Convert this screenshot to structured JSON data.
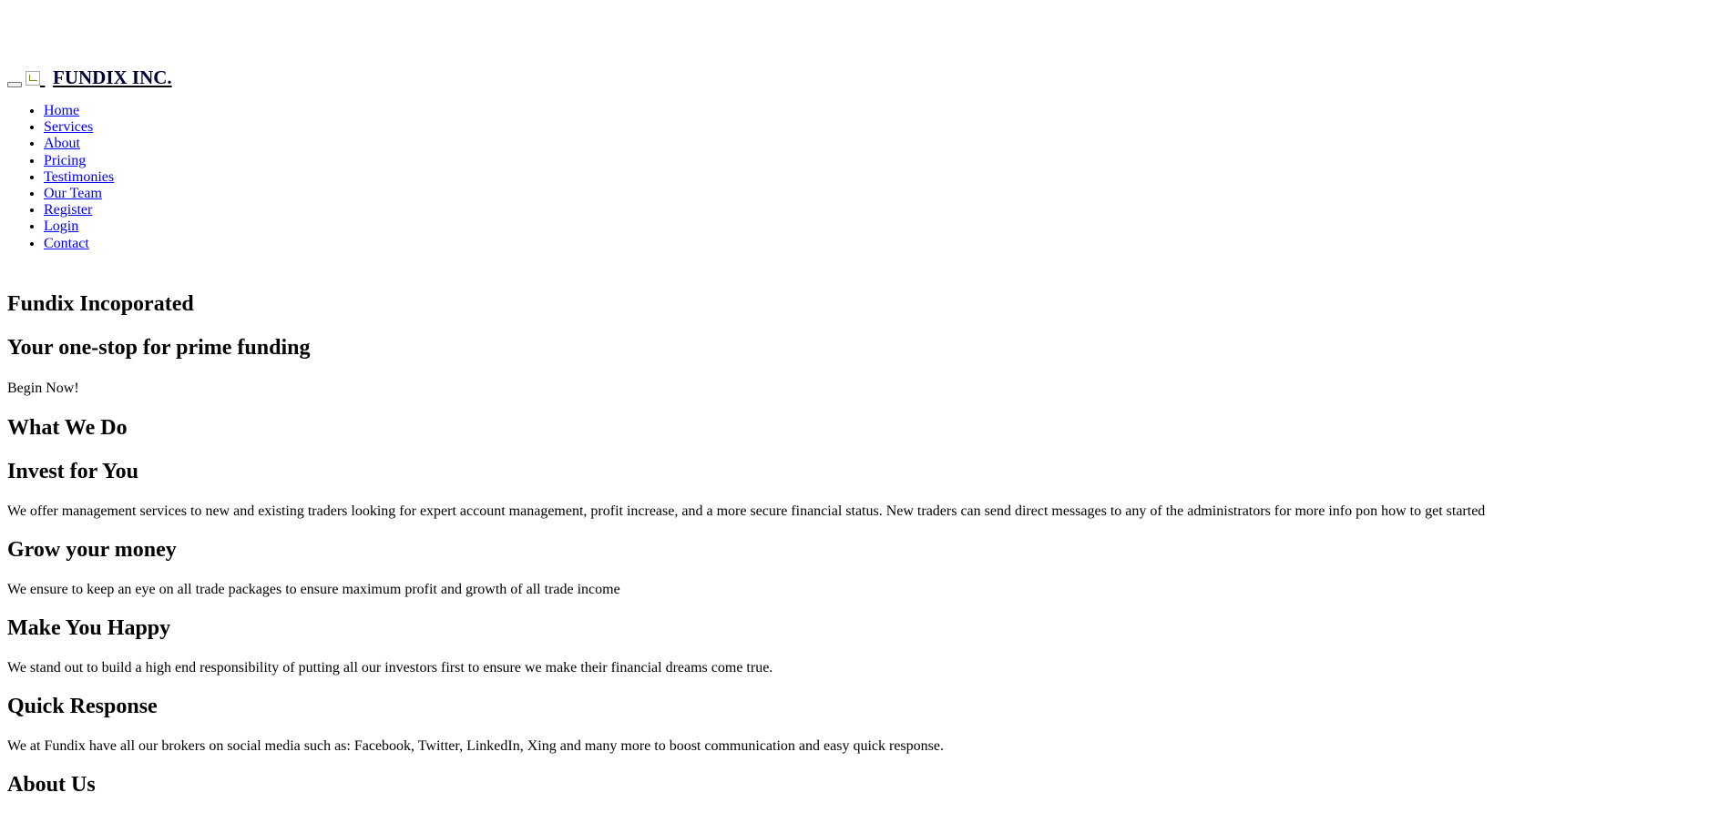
{
  "header": {
    "toggle_label": "",
    "brand": "FUNDIX INC."
  },
  "nav": {
    "items": [
      {
        "label": "Home"
      },
      {
        "label": "Services"
      },
      {
        "label": "About"
      },
      {
        "label": "Pricing"
      },
      {
        "label": "Testimonies"
      },
      {
        "label": "Our Team"
      },
      {
        "label": "Register"
      },
      {
        "label": "Login"
      },
      {
        "label": "Contact"
      }
    ]
  },
  "hero": {
    "title": "Fundix Incoporated",
    "subtitle": "Your one-stop for prime funding",
    "cta": "Begin Now!"
  },
  "services": {
    "heading": "What We Do",
    "items": [
      {
        "title": "Invest for You",
        "text": "We offer management services to new and existing traders looking for expert account management, profit increase, and a more secure financial status. New traders can send direct messages to any of the administrators for more info pon how to get started"
      },
      {
        "title": "Grow your money",
        "text": "We ensure to keep an eye on all trade packages to ensure maximum profit and growth of all trade income"
      },
      {
        "title": "Make You Happy",
        "text": "We stand out to build a high end responsibility of putting all our investors first to ensure we make their financial dreams come true."
      },
      {
        "title": "Quick Response",
        "text": "We at Fundix have all our brokers on social media such as: Facebook, Twitter, LinkedIn, Xing and many more to boost communication and easy quick response."
      }
    ]
  },
  "about": {
    "heading": "About Us"
  }
}
